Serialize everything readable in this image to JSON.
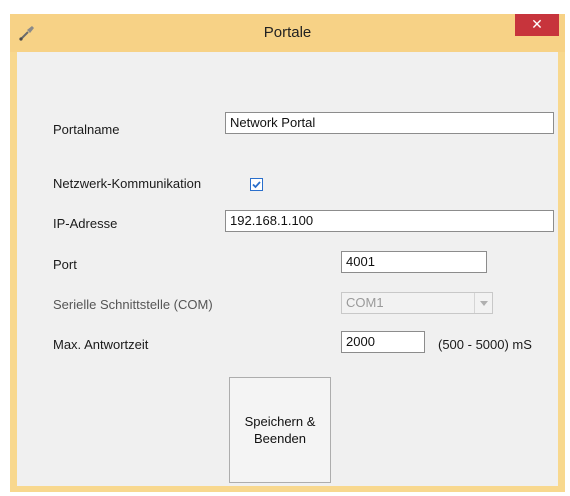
{
  "window": {
    "title": "Portale",
    "close_glyph": "✕",
    "app_icon": "pen-tool-icon",
    "accent_color": "#f7d286",
    "close_color": "#c7343c"
  },
  "form": {
    "portal_name": {
      "label": "Portalname",
      "value": "Network Portal"
    },
    "network_comm": {
      "label": "Netzwerk-Kommunikation",
      "checked": true
    },
    "ip_address": {
      "label": "IP-Adresse",
      "value": "192.168.1.100"
    },
    "port": {
      "label": "Port",
      "value": "4001"
    },
    "serial_port": {
      "label": "Serielle Schnittstelle (COM)",
      "value": "COM1",
      "disabled": true
    },
    "max_response": {
      "label": "Max. Antwortzeit",
      "value": "2000",
      "range_hint": "(500 - 5000) mS"
    }
  },
  "buttons": {
    "save_close_label": "Speichern &\nBeenden"
  }
}
